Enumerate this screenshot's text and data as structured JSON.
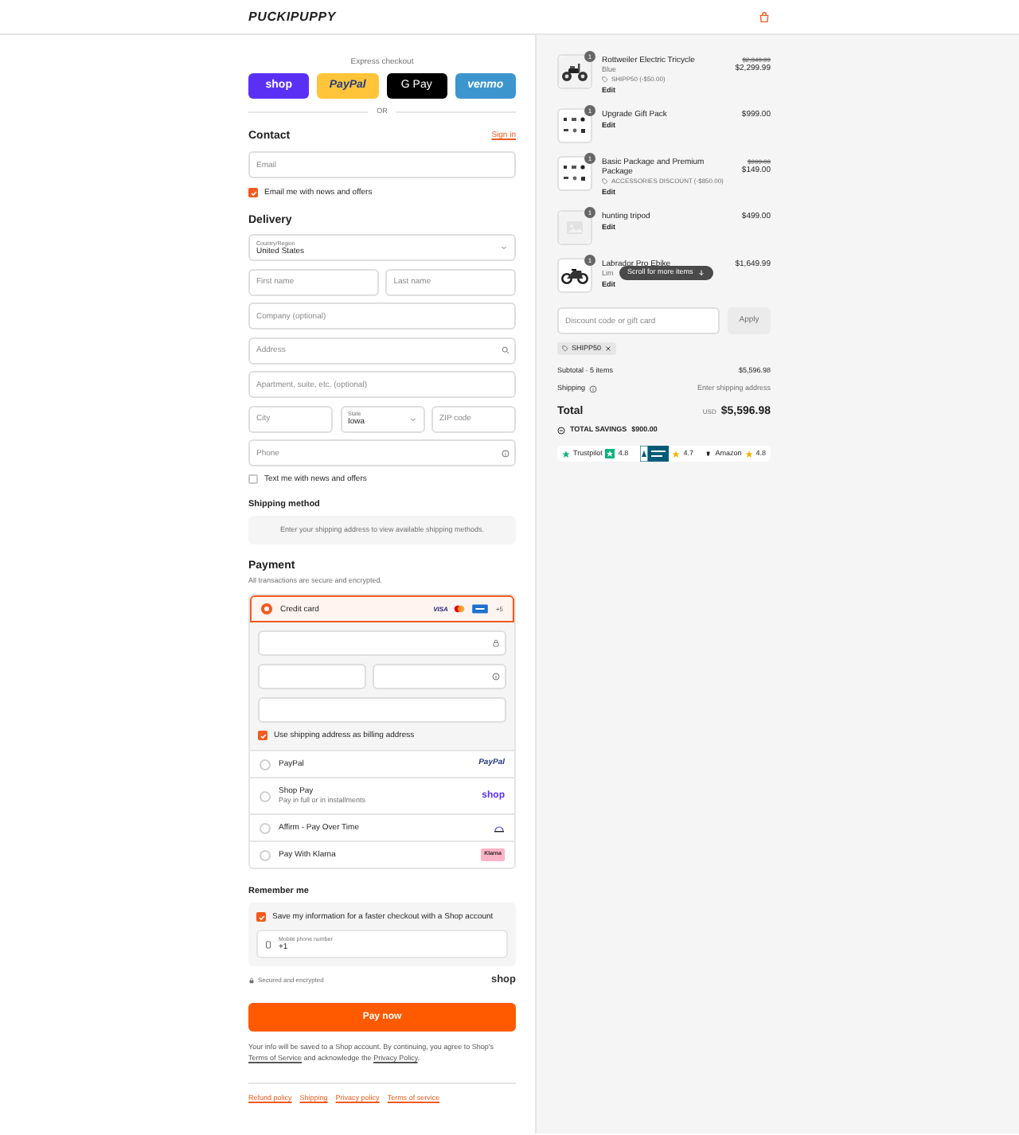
{
  "header": {
    "logo": "PUCKIPUPPY"
  },
  "express": {
    "label": "Express checkout",
    "divider": "OR",
    "buttons": [
      {
        "kind": "shop",
        "label": "shop"
      },
      {
        "kind": "paypal",
        "label": "PayPal"
      },
      {
        "kind": "gpay",
        "label": "G Pay"
      },
      {
        "kind": "venmo",
        "label": "venmo"
      }
    ]
  },
  "contact": {
    "title": "Contact",
    "sign_in": "Sign in",
    "email": {
      "placeholder": "Email"
    },
    "newsletter": {
      "label": "Email me with news and offers",
      "checked": true
    }
  },
  "delivery": {
    "title": "Delivery",
    "rows": [
      [
        {
          "kind": "select",
          "label": "Country/Region",
          "value": "United States"
        }
      ],
      [
        {
          "kind": "text",
          "placeholder": "First name"
        },
        {
          "kind": "text",
          "placeholder": "Last name"
        }
      ],
      [
        {
          "kind": "text",
          "placeholder": "Company (optional)"
        }
      ],
      [
        {
          "kind": "address",
          "placeholder": "Address"
        }
      ],
      [
        {
          "kind": "text",
          "placeholder": "Apartment, suite, etc. (optional)"
        }
      ],
      [
        {
          "kind": "text",
          "placeholder": "City"
        },
        {
          "kind": "select",
          "label": "State",
          "value": "Iowa"
        },
        {
          "kind": "text",
          "placeholder": "ZIP code"
        }
      ],
      [
        {
          "kind": "phone",
          "placeholder": "Phone"
        }
      ]
    ],
    "sms": {
      "label": "Text me with news and offers",
      "checked": false
    }
  },
  "shipping_method": {
    "title": "Shipping method",
    "message": "Enter your shipping address to view available shipping methods."
  },
  "payment": {
    "title": "Payment",
    "subtitle": "All transactions are secure and encrypted.",
    "billing": {
      "label": "Use shipping address as billing address",
      "checked": true
    },
    "methods": [
      {
        "kind": "card",
        "label": "Credit card",
        "selected": true,
        "brand": "VISA",
        "more": "+5"
      },
      {
        "kind": "paypal",
        "label": "PayPal",
        "logo": "PayPal",
        "selected": false
      },
      {
        "kind": "shop_pay",
        "label": "Shop Pay",
        "sublabel": "Pay in full or in installments",
        "logo": "shop",
        "selected": false
      },
      {
        "kind": "affirm",
        "label": "Affirm - Pay Over Time",
        "selected": false
      },
      {
        "kind": "klarna",
        "label": "Pay With Klarna",
        "logo": "Klarna",
        "selected": false
      }
    ]
  },
  "remember": {
    "title": "Remember me",
    "save": {
      "label": "Save my information for a faster checkout with a Shop account",
      "checked": true
    },
    "phone": {
      "label": "Mobile phone number",
      "value": "+1"
    }
  },
  "secure": {
    "label": "Secured and encrypted",
    "logo": "shop"
  },
  "pay_button": "Pay now",
  "legal": {
    "before": "Your info will be saved to a Shop account. By continuing, you agree to Shop's",
    "terms": "Terms of Service",
    "middle": "and acknowledge the",
    "privacy": "Privacy Policy",
    "after": "."
  },
  "footer_links": [
    "Refund policy",
    "Shipping",
    "Privacy policy",
    "Terms of service"
  ],
  "order": {
    "items": [
      {
        "kind": "tricycle",
        "quantity": "1",
        "name": "Rottweiler Electric Tricycle",
        "variant": "Blue",
        "discount": "SHIPP50 (-$50.00)",
        "original_price": "$2,349.99",
        "price": "$2,299.99",
        "edit": "Edit"
      },
      {
        "kind": "pack",
        "quantity": "1",
        "name": "Upgrade Gift Pack",
        "price": "$999.00",
        "edit": "Edit"
      },
      {
        "kind": "pack",
        "quantity": "1",
        "name": "Basic Package and Premium Package",
        "discount": "ACCESSORIES DISCOUNT (-$850.00)",
        "original_price": "$999.00",
        "price": "$149.00",
        "edit": "Edit"
      },
      {
        "kind": "placeholder",
        "quantity": "1",
        "name": "hunting tripod",
        "price": "$499.00",
        "edit": "Edit"
      },
      {
        "kind": "bike",
        "quantity": "1",
        "name": "Labrador Pro Ebike",
        "variant": "Lim",
        "price": "$1,649.99",
        "edit": "Edit"
      }
    ],
    "scroll_hint": "Scroll for more items",
    "discount": {
      "placeholder": "Discount code or gift card",
      "button": "Apply"
    },
    "codes": [
      "SHIPP50"
    ],
    "subtotal": {
      "label": "Subtotal · 5 items",
      "value": "$5,596.98"
    },
    "shipping": {
      "label": "Shipping",
      "value": "Enter shipping address"
    },
    "total": {
      "label": "Total",
      "currency": "USD",
      "value": "$5,596.98"
    },
    "savings": {
      "label": "TOTAL SAVINGS",
      "value": "$900.00"
    },
    "ratings": [
      {
        "kind": "trustpilot",
        "label": "Trustpilot",
        "score": "4.8"
      },
      {
        "kind": "bbb",
        "score": "4.7"
      },
      {
        "kind": "amazon",
        "label": "Amazon",
        "score": "4.8"
      }
    ]
  }
}
